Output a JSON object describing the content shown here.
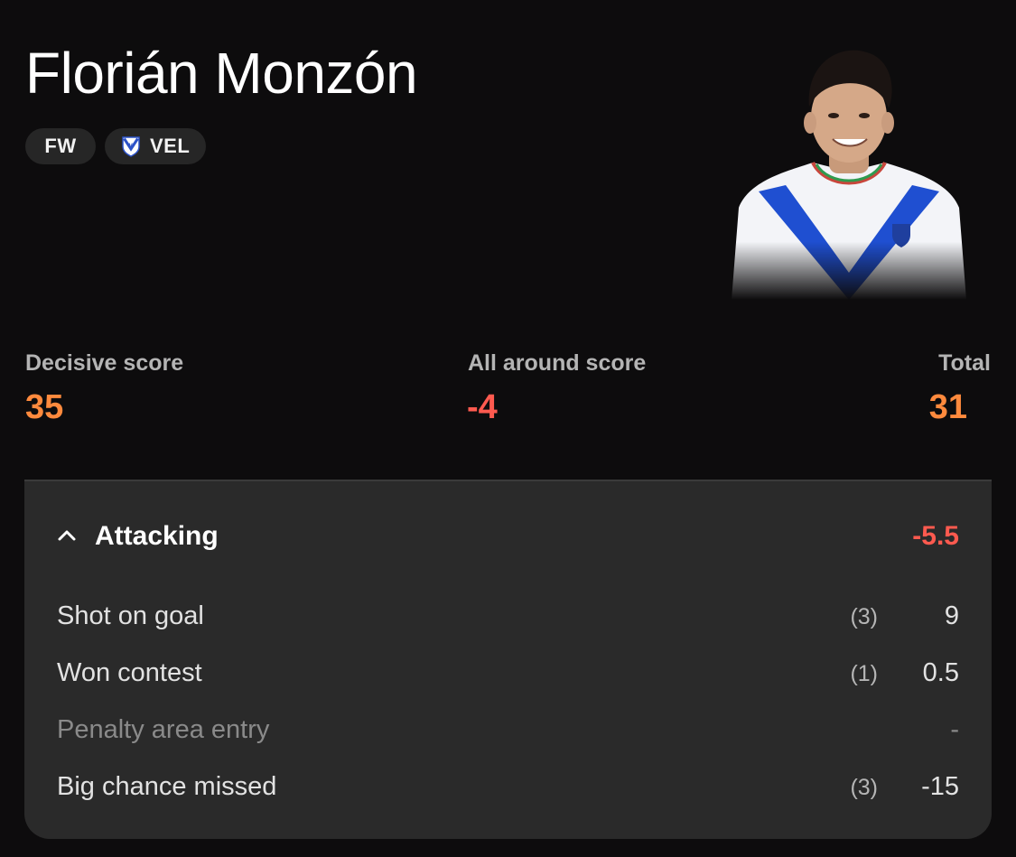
{
  "player": {
    "name": "Florián Monzón",
    "position": "FW",
    "team": "VEL"
  },
  "scores": {
    "decisive": {
      "label": "Decisive score",
      "value": "35"
    },
    "all_around": {
      "label": "All around score",
      "value": "-4"
    },
    "total": {
      "label": "Total",
      "value": "31"
    }
  },
  "section": {
    "title": "Attacking",
    "total": "-5.5",
    "rows": [
      {
        "label": "Shot on goal",
        "count": "(3)",
        "points": "9"
      },
      {
        "label": "Won contest",
        "count": "(1)",
        "points": "0.5"
      },
      {
        "label": "Penalty area entry",
        "count": "",
        "points": "-"
      },
      {
        "label": "Big chance missed",
        "count": "(3)",
        "points": "-15"
      }
    ]
  },
  "icons": {
    "chevron": "chevron-up-icon",
    "team_crest": "velez-crest-icon"
  },
  "colors": {
    "background": "#0d0c0d",
    "card": "#2a2a2a",
    "positive": "#ff8a3d",
    "negative": "#ff5a4f"
  }
}
